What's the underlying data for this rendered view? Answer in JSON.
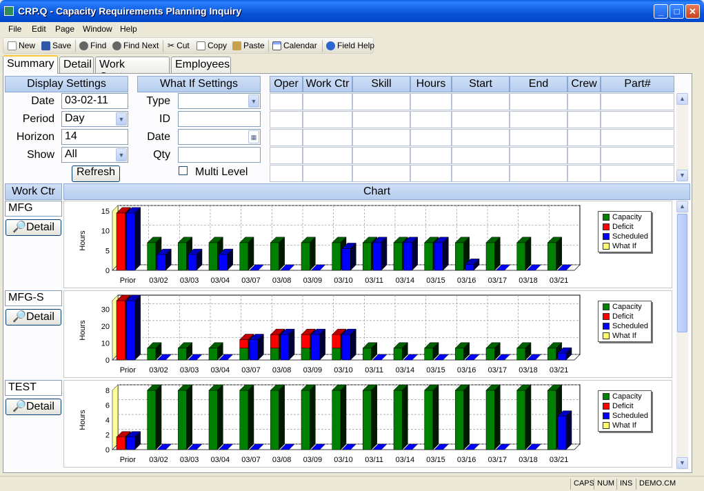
{
  "window": {
    "title": "CRP.Q - Capacity Requirements Planning Inquiry"
  },
  "menu": [
    "File",
    "Edit",
    "Page",
    "Window",
    "Help"
  ],
  "toolbar": {
    "new": "New",
    "save": "Save",
    "find": "Find",
    "find_next": "Find Next",
    "cut": "Cut",
    "copy": "Copy",
    "paste": "Paste",
    "calendar": "Calendar",
    "field_help": "Field Help"
  },
  "tabs": [
    "Summary",
    "Detail",
    "Work Centers",
    "Employees"
  ],
  "display_settings": {
    "header": "Display Settings",
    "date_label": "Date",
    "date_value": "03-02-11",
    "period_label": "Period",
    "period_value": "Day",
    "horizon_label": "Horizon",
    "horizon_value": "14",
    "show_label": "Show",
    "show_value": "All",
    "refresh": "Refresh"
  },
  "what_if": {
    "header": "What If Settings",
    "type_label": "Type",
    "type_value": "",
    "id_label": "ID",
    "id_value": "",
    "date_label": "Date",
    "date_value": "",
    "qty_label": "Qty",
    "qty_value": "",
    "multi_level": "Multi Level"
  },
  "ops_table": {
    "columns": [
      "Oper",
      "Work Ctr",
      "Skill",
      "Hours",
      "Start",
      "End",
      "Crew",
      "Part#"
    ]
  },
  "section_headers": {
    "work_ctr": "Work Ctr",
    "chart": "Chart"
  },
  "work_centers": [
    {
      "name": "MFG",
      "detail": "Detail"
    },
    {
      "name": "MFG-S",
      "detail": "Detail"
    },
    {
      "name": "TEST",
      "detail": "Detail"
    }
  ],
  "colors": {
    "capacity": "#008000",
    "deficit": "#ff0000",
    "scheduled": "#0000ff",
    "what_if": "#ffff66"
  },
  "chart_data": [
    {
      "type": "bar",
      "stacked_capacity_deficit": true,
      "ylabel": "Hours",
      "ylim": [
        0,
        15
      ],
      "yticks": [
        0,
        5,
        10,
        15
      ],
      "categories": [
        "Prior",
        "03/02",
        "03/03",
        "03/04",
        "03/07",
        "03/08",
        "03/09",
        "03/10",
        "03/11",
        "03/14",
        "03/15",
        "03/16",
        "03/17",
        "03/18",
        "03/21"
      ],
      "series": [
        {
          "name": "Capacity",
          "values": [
            0,
            7,
            7,
            7,
            7,
            7,
            7,
            7,
            7,
            7,
            7,
            7,
            7,
            7,
            7
          ]
        },
        {
          "name": "Deficit",
          "values": [
            14.5,
            0,
            0,
            0,
            0,
            0,
            0,
            0,
            0,
            0,
            0,
            0,
            0,
            0,
            0
          ]
        },
        {
          "name": "Scheduled",
          "values": [
            14.5,
            4,
            4,
            4,
            0,
            0,
            0,
            5.5,
            7,
            7,
            7,
            1.5,
            0,
            0,
            0
          ]
        },
        {
          "name": "What If",
          "values": [
            0,
            0,
            0,
            0,
            0,
            0,
            0,
            0,
            0,
            0,
            0,
            0,
            0,
            0,
            0
          ]
        }
      ],
      "legend": "right"
    },
    {
      "type": "bar",
      "stacked_capacity_deficit": true,
      "ylabel": "Hours",
      "ylim": [
        0,
        35
      ],
      "yticks": [
        0,
        10,
        20,
        30
      ],
      "categories": [
        "Prior",
        "03/02",
        "03/03",
        "03/04",
        "03/07",
        "03/08",
        "03/09",
        "03/10",
        "03/11",
        "03/14",
        "03/15",
        "03/16",
        "03/17",
        "03/18",
        "03/21"
      ],
      "series": [
        {
          "name": "Capacity",
          "values": [
            0,
            7,
            7,
            7,
            7,
            7,
            7,
            7,
            7,
            7,
            7,
            7,
            7,
            7,
            7
          ]
        },
        {
          "name": "Deficit",
          "values": [
            35,
            0,
            0,
            0,
            5,
            8,
            8,
            8,
            0,
            0,
            0,
            0,
            0,
            0,
            0
          ]
        },
        {
          "name": "Scheduled",
          "values": [
            35,
            0,
            0,
            0,
            12,
            15,
            15,
            15,
            0,
            0,
            0,
            0,
            0,
            0,
            4
          ]
        },
        {
          "name": "What If",
          "values": [
            0,
            0,
            0,
            0,
            0,
            0,
            0,
            0,
            0,
            0,
            0,
            0,
            0,
            0,
            0
          ]
        }
      ],
      "legend": "right"
    },
    {
      "type": "bar",
      "stacked_capacity_deficit": true,
      "ylabel": "Hours",
      "ylim": [
        0,
        8
      ],
      "yticks": [
        0,
        2,
        4,
        6,
        8
      ],
      "categories": [
        "Prior",
        "03/02",
        "03/03",
        "03/04",
        "03/07",
        "03/08",
        "03/09",
        "03/10",
        "03/11",
        "03/14",
        "03/15",
        "03/16",
        "03/17",
        "03/18",
        "03/21"
      ],
      "series": [
        {
          "name": "Capacity",
          "values": [
            0,
            8,
            8,
            8,
            8,
            8,
            8,
            8,
            8,
            8,
            8,
            8,
            8,
            8,
            8
          ]
        },
        {
          "name": "Deficit",
          "values": [
            1.7,
            0,
            0,
            0,
            0,
            0,
            0,
            0,
            0,
            0,
            0,
            0,
            0,
            0,
            0
          ]
        },
        {
          "name": "Scheduled",
          "values": [
            1.7,
            0,
            0,
            0,
            0,
            0,
            0,
            0,
            0,
            0,
            0,
            0,
            0,
            0,
            4.5
          ]
        },
        {
          "name": "What If",
          "values": [
            0,
            0,
            0,
            0,
            0,
            0,
            0,
            0,
            0,
            0,
            0,
            0,
            0,
            0,
            0
          ]
        }
      ],
      "legend": "right"
    }
  ],
  "status": {
    "caps": "CAPS",
    "num": "NUM",
    "ins": "INS",
    "server": "DEMO.CM"
  }
}
